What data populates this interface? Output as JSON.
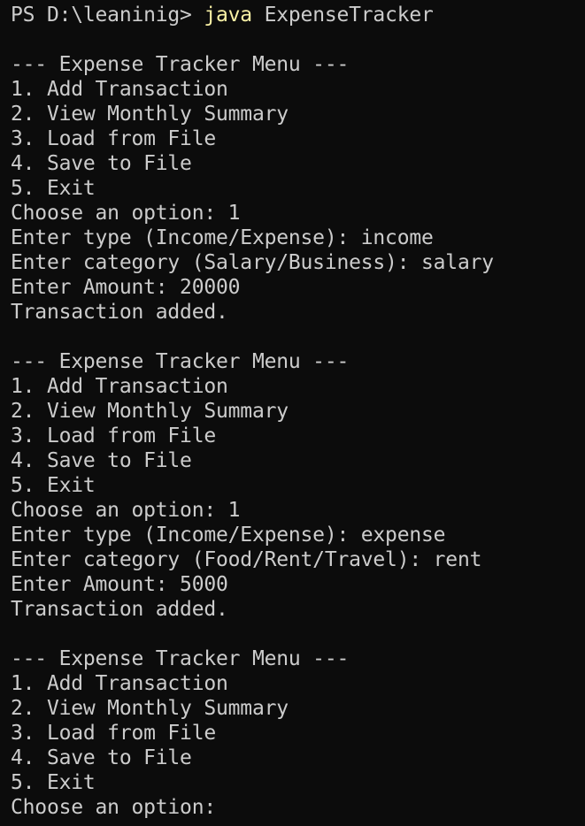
{
  "prompt": {
    "text": "PS D:\\leaninig> ",
    "command": "java",
    "args": " ExpenseTracker"
  },
  "lines": [
    "",
    "--- Expense Tracker Menu ---",
    "1. Add Transaction",
    "2. View Monthly Summary",
    "3. Load from File",
    "4. Save to File",
    "5. Exit",
    "Choose an option: 1",
    "Enter type (Income/Expense): income",
    "Enter category (Salary/Business): salary",
    "Enter Amount: 20000",
    "Transaction added.",
    "",
    "--- Expense Tracker Menu ---",
    "1. Add Transaction",
    "2. View Monthly Summary",
    "3. Load from File",
    "4. Save to File",
    "5. Exit",
    "Choose an option: 1",
    "Enter type (Income/Expense): expense",
    "Enter category (Food/Rent/Travel): rent",
    "Enter Amount: 5000",
    "Transaction added.",
    "",
    "--- Expense Tracker Menu ---",
    "1. Add Transaction",
    "2. View Monthly Summary",
    "3. Load from File",
    "4. Save to File",
    "5. Exit",
    "Choose an option: "
  ],
  "colors": {
    "background": "#0c0c0c",
    "text": "#cccccc",
    "command": "#f9f1a5"
  }
}
